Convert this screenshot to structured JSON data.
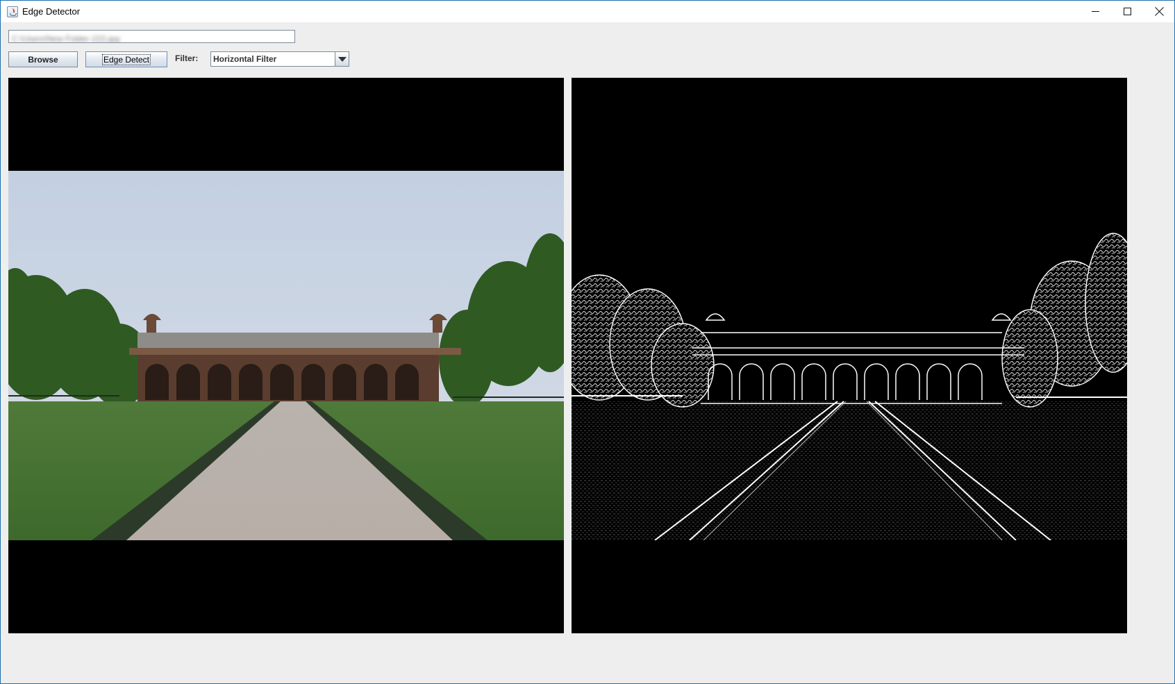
{
  "window": {
    "title": "Edge Detector"
  },
  "path_field": {
    "value": "C:\\Users\\New Folder (22).jpg"
  },
  "toolbar": {
    "browse_label": "Browse",
    "edge_detect_label": "Edge Detect",
    "filter_label": "Filter:",
    "filter_selected": "Horizontal Filter"
  },
  "icons": {
    "app": "java-cup-icon",
    "minimize": "minimize-icon",
    "maximize": "maximize-icon",
    "close": "close-icon",
    "dropdown": "chevron-down-icon"
  },
  "colors": {
    "panel_background": "#000000",
    "window_background": "#eeeeee",
    "button_border": "#7a8a99"
  }
}
